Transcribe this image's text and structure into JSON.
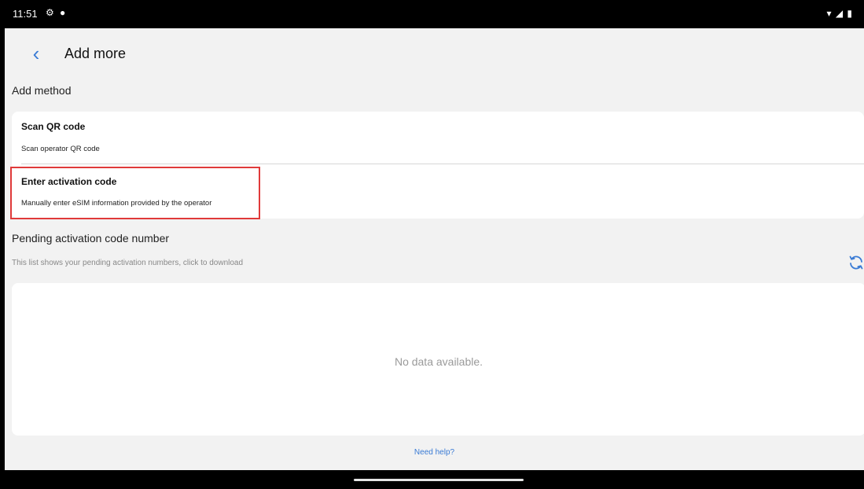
{
  "status_bar": {
    "time": "11:51"
  },
  "header": {
    "back_icon": "‹",
    "title": "Add more"
  },
  "add_method": {
    "label": "Add method",
    "options": [
      {
        "title": "Scan QR code",
        "subtitle": "Scan operator QR code"
      },
      {
        "title": "Enter activation code",
        "subtitle": "Manually enter eSIM information provided by the operator"
      }
    ]
  },
  "pending": {
    "title": "Pending activation code number",
    "subtitle": "This list shows your pending activation numbers, click to download",
    "empty_text": "No data available."
  },
  "help_link": "Need help?",
  "colors": {
    "accent": "#3a7bd5",
    "highlight": "#e03a3a"
  }
}
